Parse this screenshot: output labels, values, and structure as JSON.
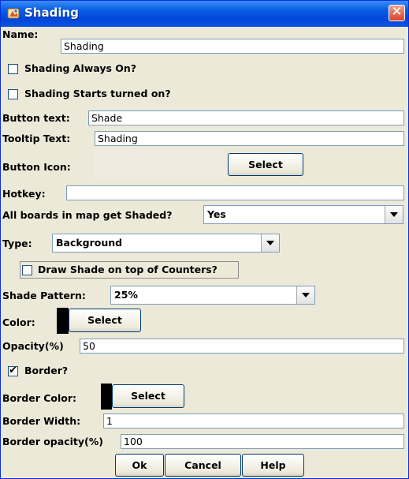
{
  "window": {
    "title": "Shading"
  },
  "fields": {
    "name": {
      "label": "Name:",
      "value": "Shading"
    },
    "always_on": {
      "label": "Shading Always On?",
      "checked": false
    },
    "starts_on": {
      "label": "Shading Starts turned on?",
      "checked": false
    },
    "button_text": {
      "label": "Button text:",
      "value": "Shade"
    },
    "tooltip": {
      "label": "Tooltip Text:",
      "value": "Shading"
    },
    "button_icon": {
      "label": "Button Icon:",
      "select": "Select"
    },
    "hotkey": {
      "label": "Hotkey:",
      "value": ""
    },
    "all_boards": {
      "label": "All boards in map get Shaded?",
      "value": "Yes"
    },
    "type": {
      "label": "Type:",
      "value": "Background"
    },
    "draw_on_top": {
      "label": "Draw Shade on top of Counters?",
      "checked": false
    },
    "shade_pattern": {
      "label": "Shade Pattern:",
      "value": "25%"
    },
    "color": {
      "label": "Color:",
      "select": "Select",
      "swatch": "#000000"
    },
    "opacity": {
      "label": "Opacity(%)",
      "value": "50"
    },
    "border": {
      "label": "Border?",
      "checked": true
    },
    "border_color": {
      "label": "Border Color:",
      "select": "Select",
      "swatch": "#000000"
    },
    "border_width": {
      "label": "Border Width:",
      "value": "1"
    },
    "border_opacity": {
      "label": "Border opacity(%)",
      "value": "100"
    }
  },
  "buttons": {
    "ok": "Ok",
    "cancel": "Cancel",
    "help": "Help"
  },
  "icons": {
    "title": "app-icon",
    "close": "close-icon",
    "check": "checkmark-icon",
    "dropdown": "chevron-down-icon"
  },
  "colors": {
    "titlebar": "#0a5fe3",
    "panel": "#ece9d8",
    "close": "#d8442a"
  }
}
